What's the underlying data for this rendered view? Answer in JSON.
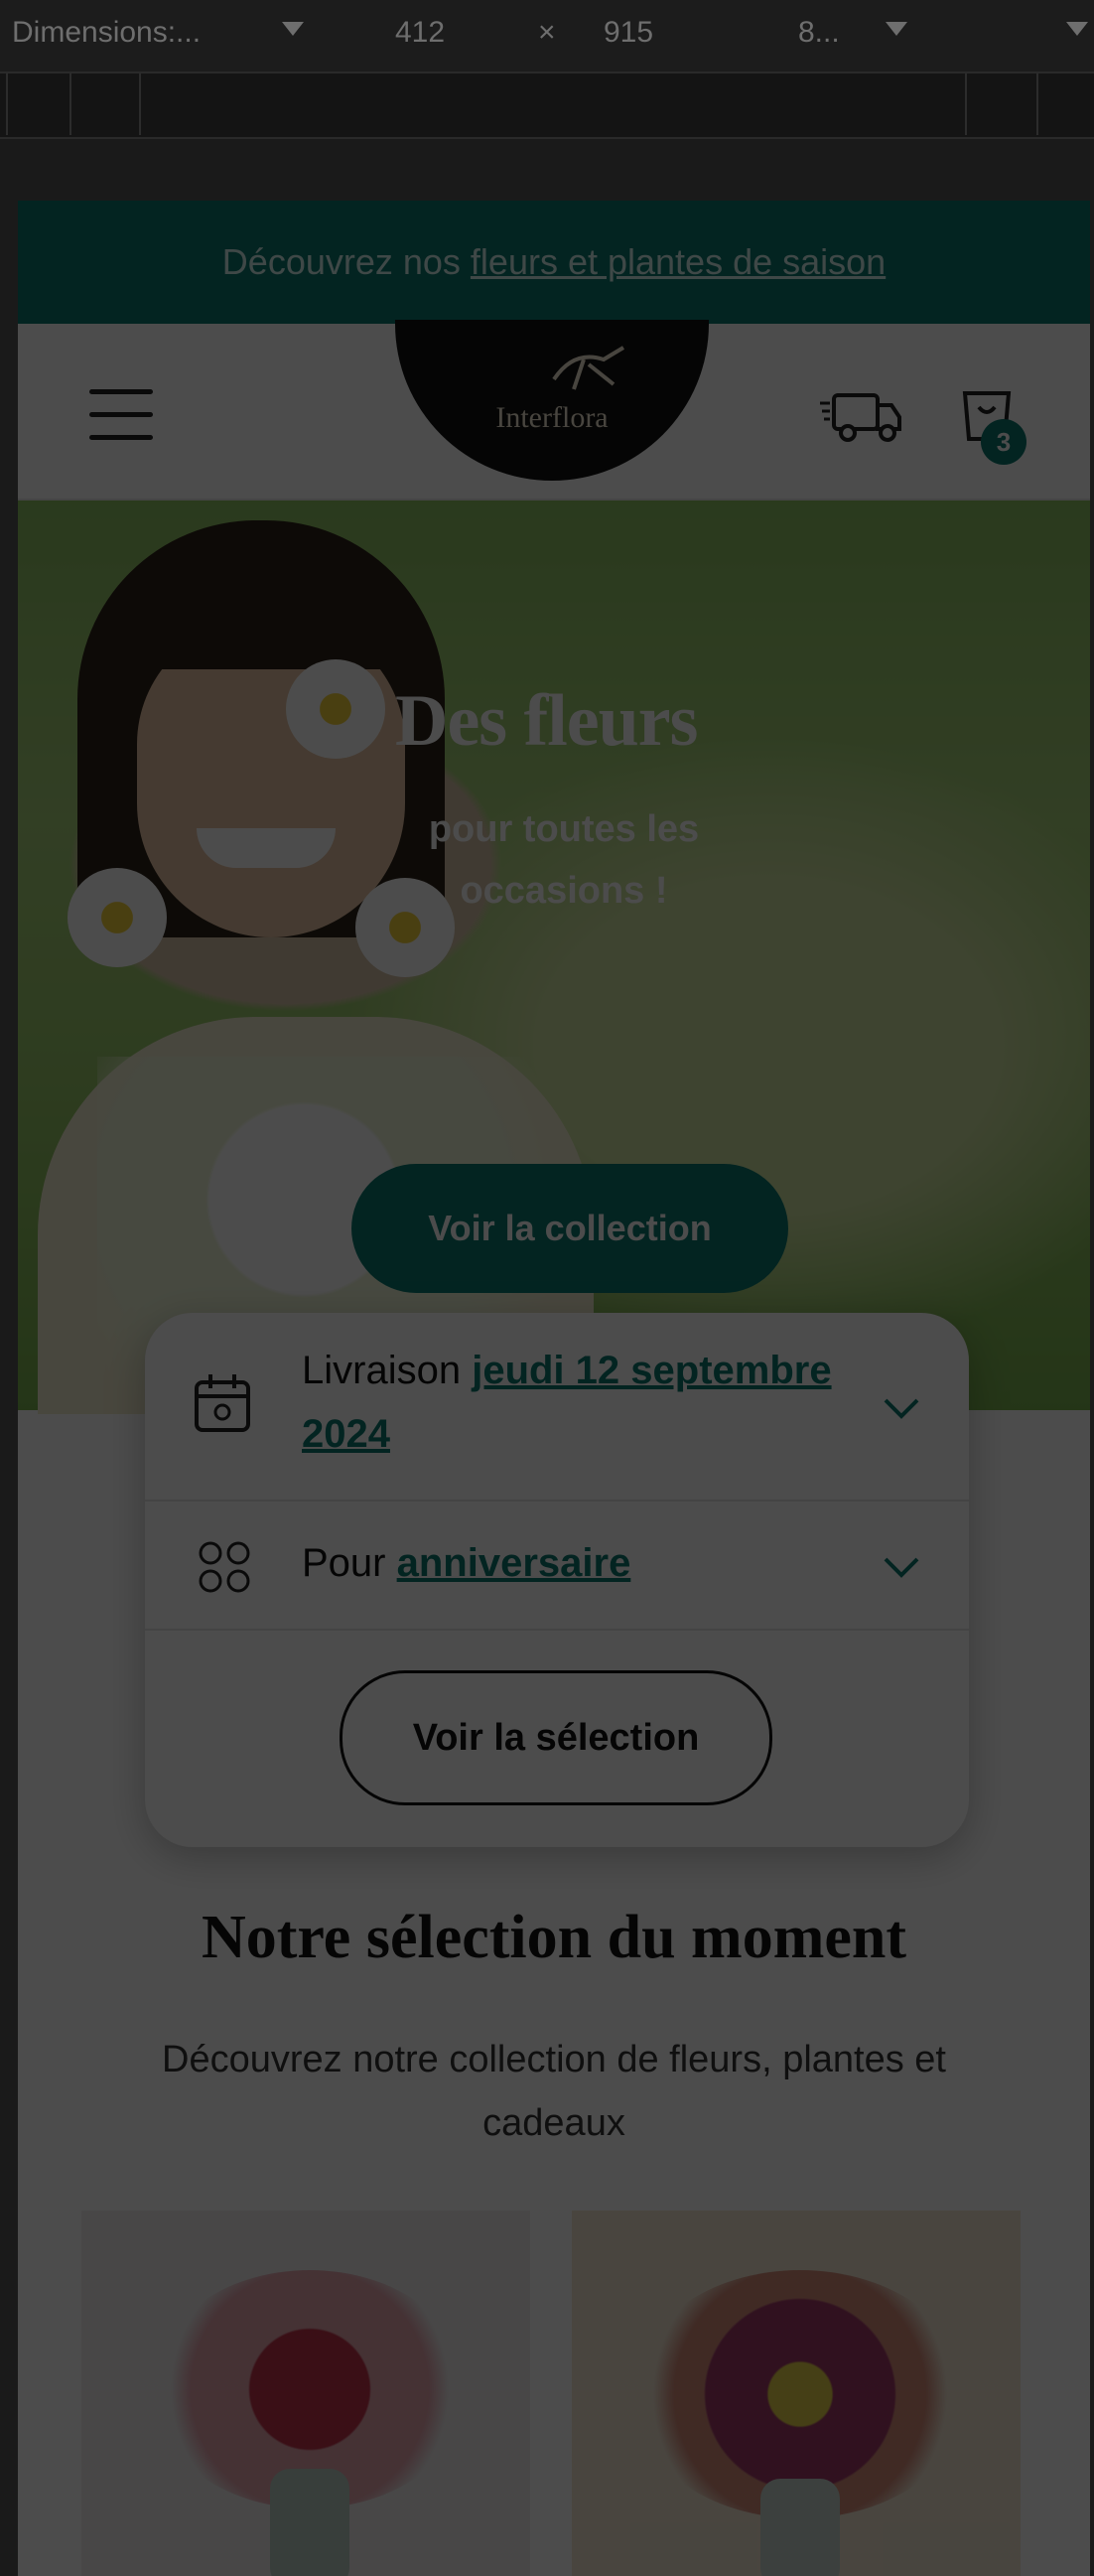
{
  "devtools": {
    "dimensions_label": "Dimensions:...",
    "width": "412",
    "times": "×",
    "height": "915",
    "zoom": "8..."
  },
  "banner": {
    "text": "Découvrez nos",
    "link": "fleurs et plantes de saison"
  },
  "header": {
    "logo_text": "Interflora",
    "cart_count": "3"
  },
  "hero": {
    "title": "Des fleurs",
    "subtitle": "pour toutes les occasions !",
    "cta": "Voir la collection"
  },
  "selector": {
    "delivery_prefix": "Livraison",
    "delivery_date": "jeudi 12 septembre 2024",
    "occasion_prefix": "Pour",
    "occasion": "anniversaire",
    "button": "Voir la sélection"
  },
  "section": {
    "title": "Notre sélection du moment",
    "subtitle": "Découvrez notre collection de fleurs, plantes et cadeaux"
  },
  "colors": {
    "brand_teal": "#0a7a70",
    "devtools_bg": "#1c1c1c"
  }
}
